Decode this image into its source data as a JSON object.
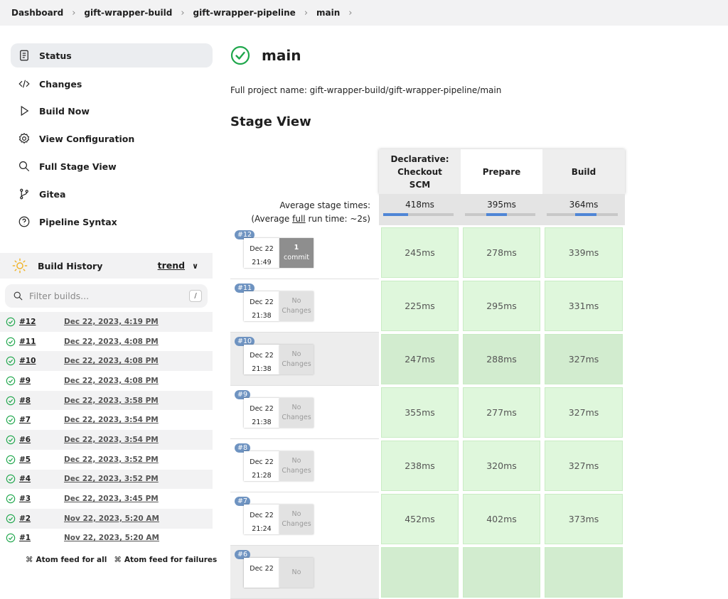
{
  "breadcrumb": [
    "Dashboard",
    "gift-wrapper-build",
    "gift-wrapper-pipeline",
    "main"
  ],
  "sidebar": {
    "items": [
      {
        "label": "Status",
        "icon": "document-icon"
      },
      {
        "label": "Changes",
        "icon": "code-icon"
      },
      {
        "label": "Build Now",
        "icon": "play-icon"
      },
      {
        "label": "View Configuration",
        "icon": "gear-icon"
      },
      {
        "label": "Full Stage View",
        "icon": "search-icon"
      },
      {
        "label": "Gitea",
        "icon": "branch-icon"
      },
      {
        "label": "Pipeline Syntax",
        "icon": "help-icon"
      }
    ]
  },
  "build_history": {
    "title": "Build History",
    "trend": "trend",
    "filter_placeholder": "Filter builds...",
    "filter_shortcut": "/",
    "builds": [
      {
        "num": "#12",
        "date": "Dec 22, 2023, 4:19 PM"
      },
      {
        "num": "#11",
        "date": "Dec 22, 2023, 4:08 PM"
      },
      {
        "num": "#10",
        "date": "Dec 22, 2023, 4:08 PM"
      },
      {
        "num": "#9",
        "date": "Dec 22, 2023, 4:08 PM"
      },
      {
        "num": "#8",
        "date": "Dec 22, 2023, 3:58 PM"
      },
      {
        "num": "#7",
        "date": "Dec 22, 2023, 3:54 PM"
      },
      {
        "num": "#6",
        "date": "Dec 22, 2023, 3:54 PM"
      },
      {
        "num": "#5",
        "date": "Dec 22, 2023, 3:52 PM"
      },
      {
        "num": "#4",
        "date": "Dec 22, 2023, 3:52 PM"
      },
      {
        "num": "#3",
        "date": "Dec 22, 2023, 3:45 PM"
      },
      {
        "num": "#2",
        "date": "Nov 22, 2023, 5:20 AM"
      },
      {
        "num": "#1",
        "date": "Nov 22, 2023, 5:20 AM"
      }
    ],
    "atom_all": "Atom feed for all",
    "atom_failures": "Atom feed for failures"
  },
  "main": {
    "title": "main",
    "full_name_label": "Full project name: gift-wrapper-build/gift-wrapper-pipeline/main",
    "stage_view_title": "Stage View"
  },
  "stage_view": {
    "stages": [
      "Declarative: Checkout SCM",
      "Prepare",
      "Build"
    ],
    "avg_label_1": "Average stage times:",
    "avg_label_2a": "(Average ",
    "avg_label_full": "full",
    "avg_label_2b": " run time: ~2s)",
    "avg_times": [
      "418ms",
      "395ms",
      "364ms"
    ],
    "avg_progress": [
      0.35,
      0.6,
      0.7
    ],
    "runs": [
      {
        "tag": "#12",
        "month": "Dec 22",
        "time": "21:49",
        "changes_a": "1",
        "changes_b": "commit",
        "has_commit": true,
        "times": [
          "245ms",
          "278ms",
          "339ms"
        ]
      },
      {
        "tag": "#11",
        "month": "Dec 22",
        "time": "21:38",
        "changes_a": "No",
        "changes_b": "Changes",
        "has_commit": false,
        "times": [
          "225ms",
          "295ms",
          "331ms"
        ]
      },
      {
        "tag": "#10",
        "month": "Dec 22",
        "time": "21:38",
        "changes_a": "No",
        "changes_b": "Changes",
        "has_commit": false,
        "times": [
          "247ms",
          "288ms",
          "327ms"
        ]
      },
      {
        "tag": "#9",
        "month": "Dec 22",
        "time": "21:38",
        "changes_a": "No",
        "changes_b": "Changes",
        "has_commit": false,
        "times": [
          "355ms",
          "277ms",
          "327ms"
        ]
      },
      {
        "tag": "#8",
        "month": "Dec 22",
        "time": "21:28",
        "changes_a": "No",
        "changes_b": "Changes",
        "has_commit": false,
        "times": [
          "238ms",
          "320ms",
          "327ms"
        ]
      },
      {
        "tag": "#7",
        "month": "Dec 22",
        "time": "21:24",
        "changes_a": "No",
        "changes_b": "Changes",
        "has_commit": false,
        "times": [
          "452ms",
          "402ms",
          "373ms"
        ]
      },
      {
        "tag": "#6",
        "month": "Dec 22",
        "time": "",
        "changes_a": "No",
        "changes_b": "",
        "has_commit": false,
        "times": [
          "",
          "",
          ""
        ]
      }
    ]
  },
  "colors": {
    "success": "#1ea64b",
    "accent": "#4f86d6"
  }
}
